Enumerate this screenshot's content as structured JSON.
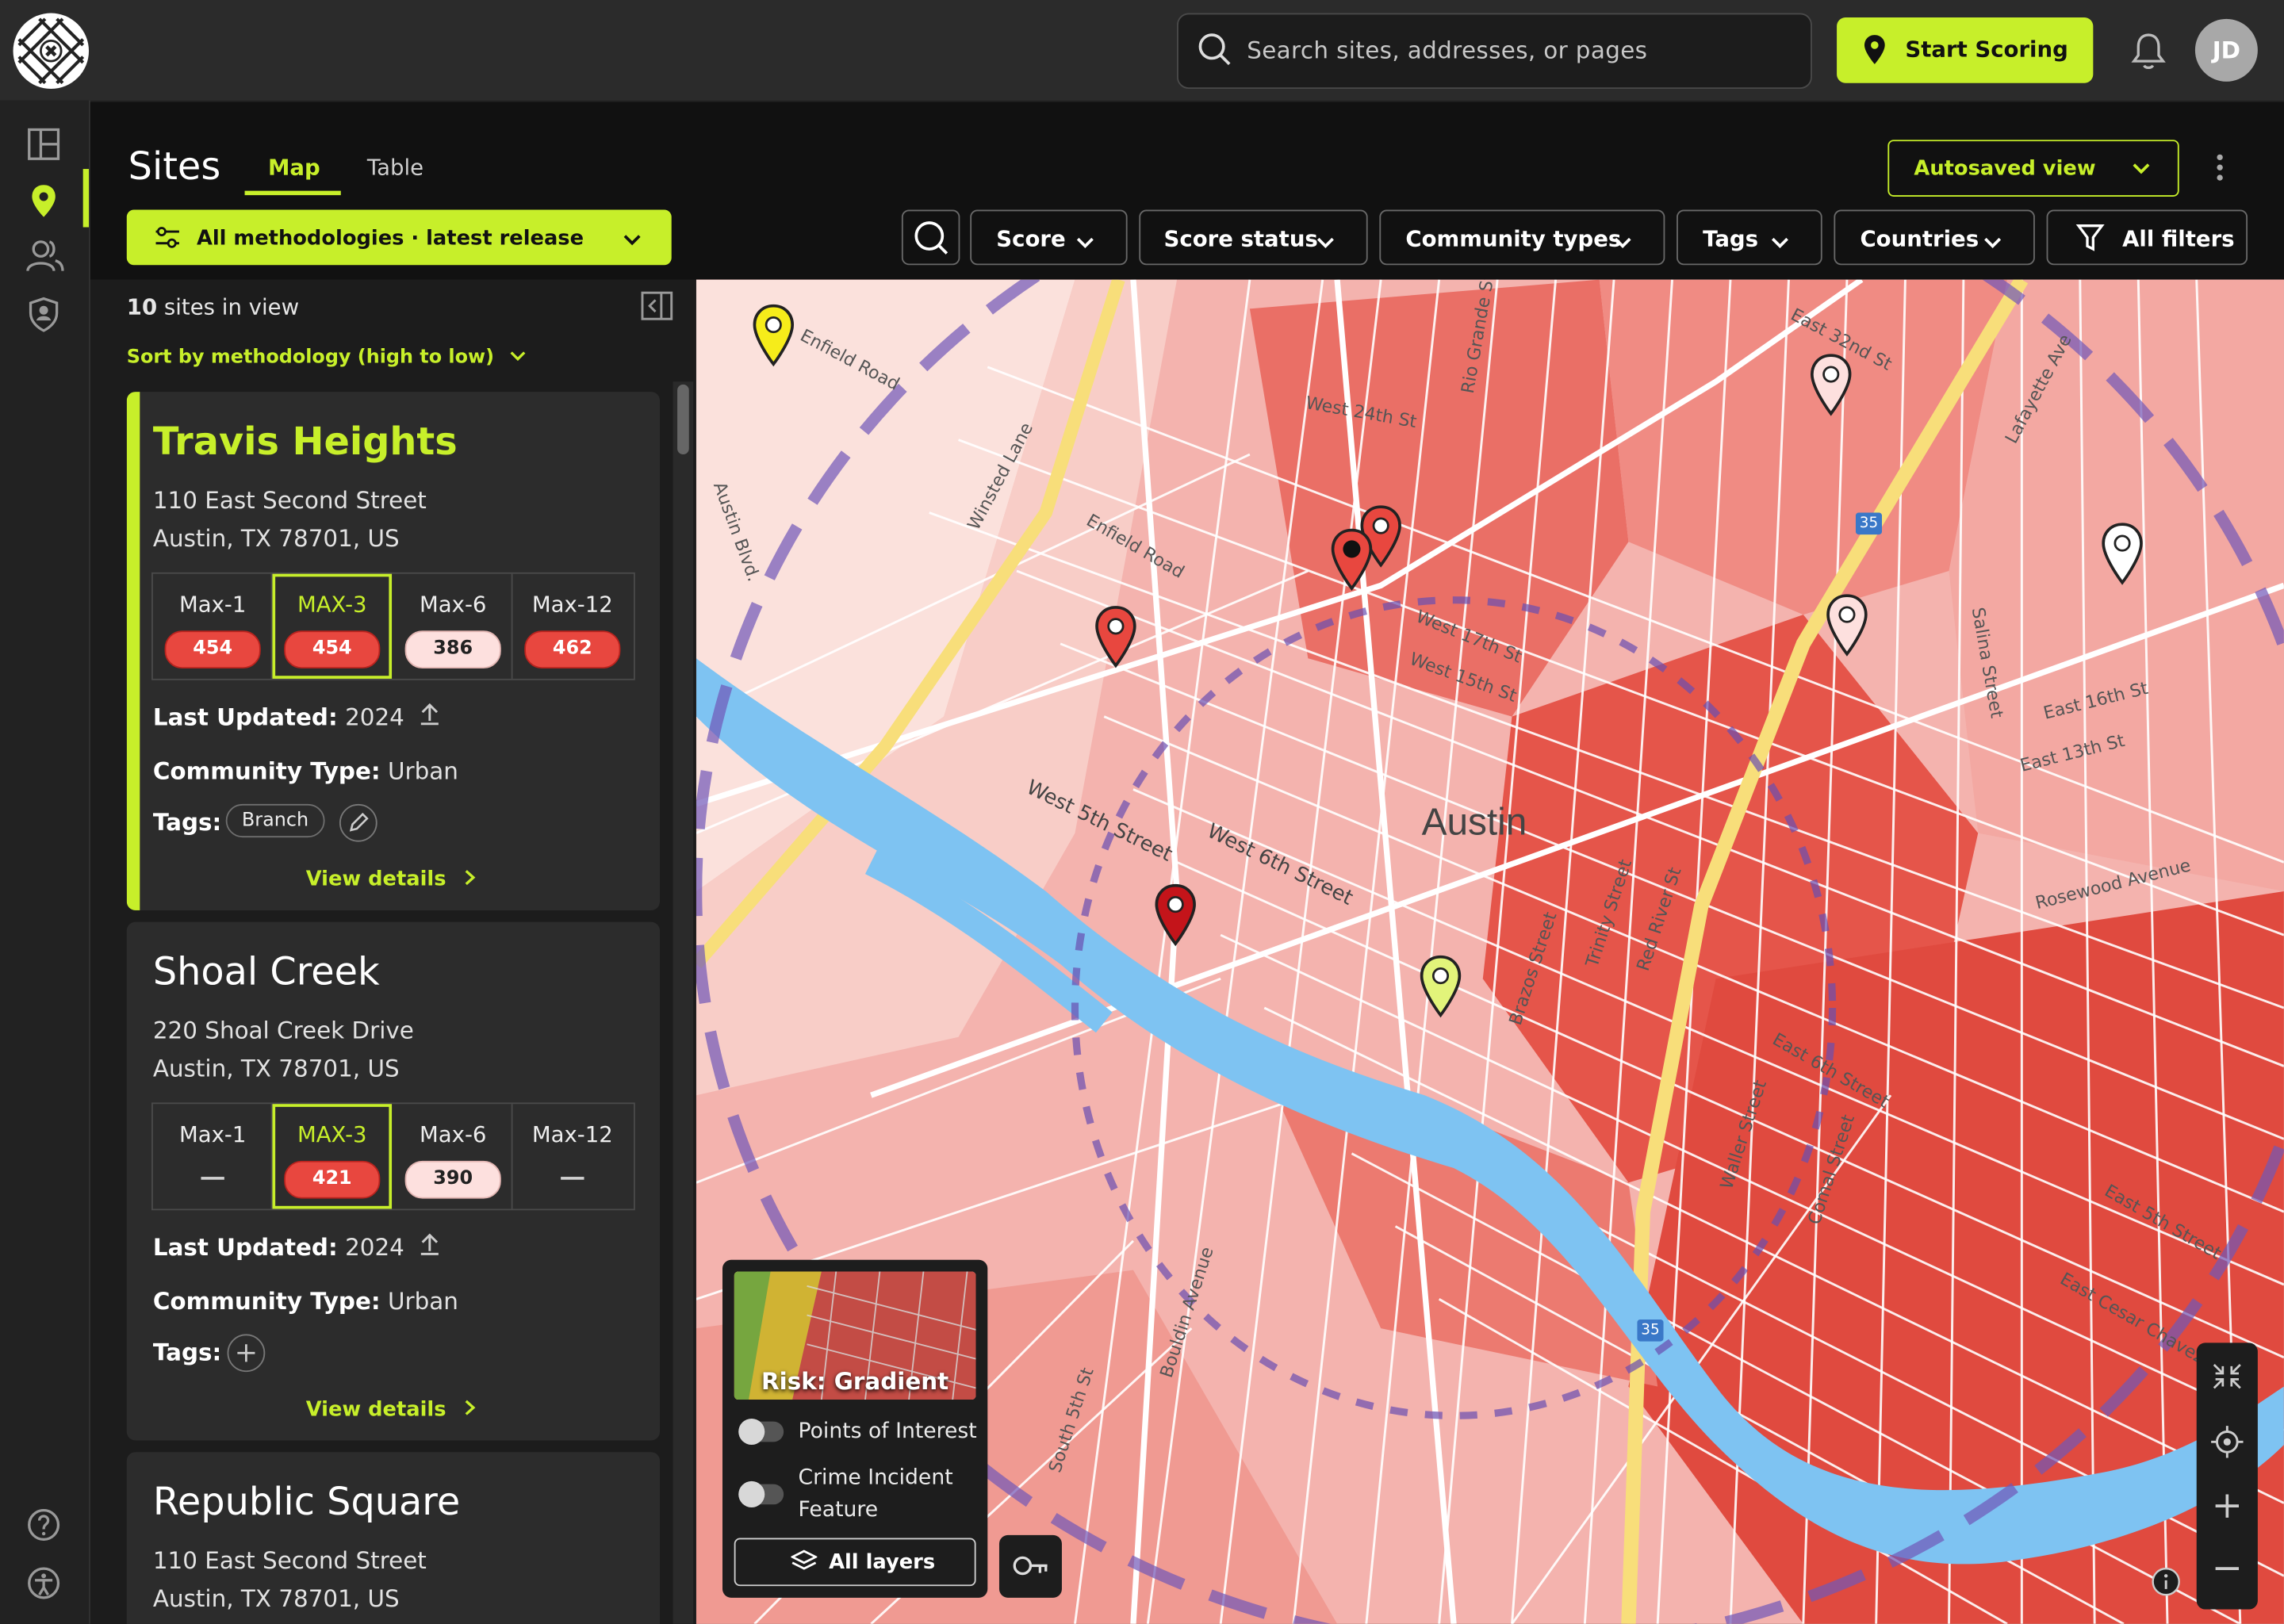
{
  "topbar": {
    "search_placeholder": "Search sites, addresses, or pages",
    "start_scoring": "Start Scoring",
    "avatar_initials": "JD"
  },
  "header": {
    "title": "Sites",
    "tabs": [
      {
        "label": "Map",
        "active": true
      },
      {
        "label": "Table",
        "active": false
      }
    ],
    "autosaved_view": "Autosaved view",
    "methodology": "All methodologies · latest release",
    "filters": [
      "Score",
      "Score status",
      "Community types",
      "Tags",
      "Countries"
    ],
    "all_filters": "All filters"
  },
  "list": {
    "site_count_num": "10",
    "site_count_text": "sites in view",
    "sort_label": "Sort by methodology (high to low)",
    "sites": [
      {
        "name": "Travis Heights",
        "address1": "110 East Second Street",
        "address2": "Austin, TX 78701, US",
        "scores": [
          {
            "label": "Max-1",
            "value": "454",
            "style": "red"
          },
          {
            "label": "MAX-3",
            "value": "454",
            "style": "red",
            "selected": true
          },
          {
            "label": "Max-6",
            "value": "386",
            "style": "pink"
          },
          {
            "label": "Max-12",
            "value": "462",
            "style": "red"
          }
        ],
        "last_updated_label": "Last Updated:",
        "last_updated": "2024",
        "community_type_label": "Community Type:",
        "community_type": "Urban",
        "tags_label": "Tags:",
        "tags": [
          "Branch"
        ],
        "view_details": "View details"
      },
      {
        "name": "Shoal Creek",
        "address1": "220 Shoal Creek Drive",
        "address2": "Austin, TX 78701, US",
        "scores": [
          {
            "label": "Max-1",
            "value": "",
            "style": "none"
          },
          {
            "label": "MAX-3",
            "value": "421",
            "style": "red",
            "selected": true
          },
          {
            "label": "Max-6",
            "value": "390",
            "style": "pink"
          },
          {
            "label": "Max-12",
            "value": "",
            "style": "none"
          }
        ],
        "last_updated_label": "Last Updated:",
        "last_updated": "2024",
        "community_type_label": "Community Type:",
        "community_type": "Urban",
        "tags_label": "Tags:",
        "tags": [],
        "view_details": "View details"
      },
      {
        "name": "Republic Square",
        "address1": "110 East Second Street",
        "address2": "Austin, TX 78701, US"
      }
    ]
  },
  "map": {
    "city_label": "Austin",
    "street_labels": [
      "Enfield Road",
      "West 24th St",
      "Rio Grande St",
      "Winsted Lane",
      "Enfield Road",
      "Austin Blvd.",
      "West 17th St",
      "West 15th St",
      "East 32nd St",
      "Lafayette Ave",
      "Salina Street",
      "East 16th St",
      "East 13th St",
      "Rosewood Avenue",
      "West 5th Street",
      "West 6th Street",
      "Brazos Street",
      "Trinity Street",
      "Red River St",
      "East 6th Street",
      "Waller Street",
      "Comal Street",
      "East 5th Street",
      "East Cesar Chavez",
      "Bouldin Avenue",
      "South 5th St",
      "35",
      "35"
    ],
    "legend": {
      "layer_title": "Risk: Gradient",
      "toggles": [
        {
          "label": "Points of Interest",
          "on": false
        },
        {
          "label": "Crime Incident Feature",
          "on": false
        }
      ],
      "all_layers": "All layers"
    }
  },
  "colors": {
    "accent": "#c7ef2a",
    "risk_red": "#e8473f",
    "risk_pink": "#fde0de",
    "water": "#7ec3f2"
  }
}
